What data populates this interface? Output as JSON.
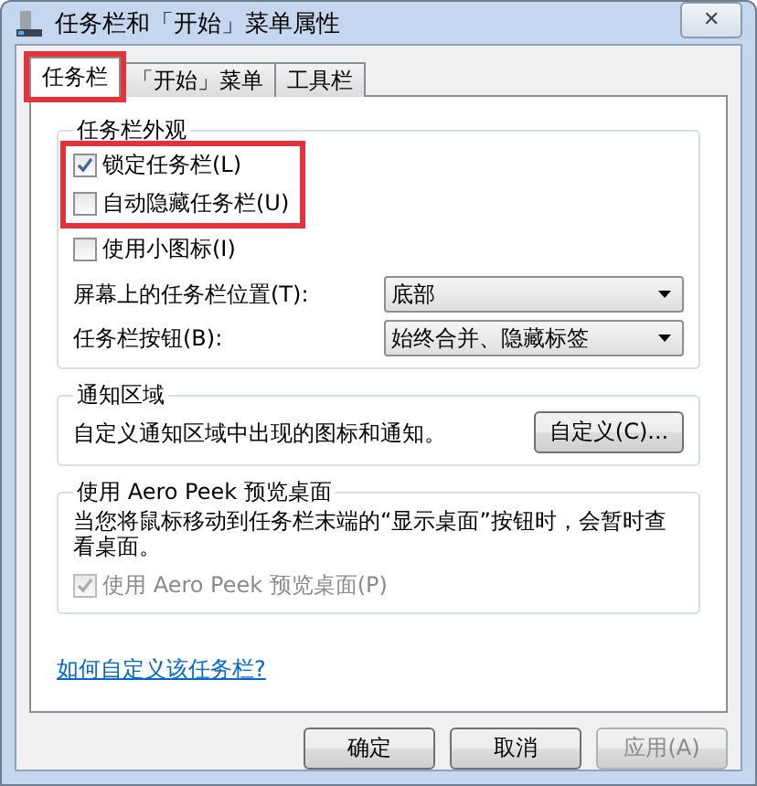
{
  "window": {
    "title": "任务栏和「开始」菜单属性",
    "close": "✕"
  },
  "tabs": [
    {
      "label": "任务栏",
      "selected": true,
      "highlighted": true
    },
    {
      "label": "「开始」菜单",
      "selected": false,
      "highlighted": false
    },
    {
      "label": "工具栏",
      "selected": false,
      "highlighted": false
    }
  ],
  "appearance": {
    "title": "任务栏外观",
    "checkboxes": [
      {
        "label": "锁定任务栏(L)",
        "checked": true,
        "highlighted": true
      },
      {
        "label": "自动隐藏任务栏(U)",
        "checked": false,
        "highlighted": true
      },
      {
        "label": "使用小图标(I)",
        "checked": false,
        "highlighted": false
      }
    ],
    "dropdowns": [
      {
        "label": "屏幕上的任务栏位置(T):",
        "value": "底部"
      },
      {
        "label": "任务栏按钮(B):",
        "value": "始终合并、隐藏标签"
      }
    ]
  },
  "notification": {
    "title": "通知区域",
    "text": "自定义通知区域中出现的图标和通知。",
    "button": "自定义(C)..."
  },
  "aero_peek": {
    "title": "使用 Aero Peek 预览桌面",
    "text": "当您将鼠标移动到任务栏末端的“显示桌面”按钮时，会暂时查看桌面。",
    "checkbox": {
      "label": "使用 Aero Peek 预览桌面(P)",
      "checked": true,
      "disabled": true
    }
  },
  "help_link": "如何自定义该任务栏?",
  "buttons": [
    {
      "label": "确定",
      "disabled": false
    },
    {
      "label": "取消",
      "disabled": false
    },
    {
      "label": "应用(A)",
      "disabled": true
    }
  ]
}
